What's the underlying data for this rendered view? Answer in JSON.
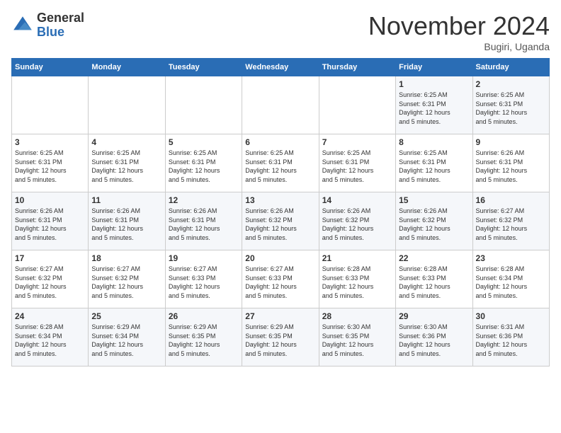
{
  "logo": {
    "general": "General",
    "blue": "Blue"
  },
  "header": {
    "month": "November 2024",
    "location": "Bugiri, Uganda"
  },
  "weekdays": [
    "Sunday",
    "Monday",
    "Tuesday",
    "Wednesday",
    "Thursday",
    "Friday",
    "Saturday"
  ],
  "weeks": [
    [
      {
        "day": "",
        "info": ""
      },
      {
        "day": "",
        "info": ""
      },
      {
        "day": "",
        "info": ""
      },
      {
        "day": "",
        "info": ""
      },
      {
        "day": "",
        "info": ""
      },
      {
        "day": "1",
        "info": "Sunrise: 6:25 AM\nSunset: 6:31 PM\nDaylight: 12 hours\nand 5 minutes."
      },
      {
        "day": "2",
        "info": "Sunrise: 6:25 AM\nSunset: 6:31 PM\nDaylight: 12 hours\nand 5 minutes."
      }
    ],
    [
      {
        "day": "3",
        "info": "Sunrise: 6:25 AM\nSunset: 6:31 PM\nDaylight: 12 hours\nand 5 minutes."
      },
      {
        "day": "4",
        "info": "Sunrise: 6:25 AM\nSunset: 6:31 PM\nDaylight: 12 hours\nand 5 minutes."
      },
      {
        "day": "5",
        "info": "Sunrise: 6:25 AM\nSunset: 6:31 PM\nDaylight: 12 hours\nand 5 minutes."
      },
      {
        "day": "6",
        "info": "Sunrise: 6:25 AM\nSunset: 6:31 PM\nDaylight: 12 hours\nand 5 minutes."
      },
      {
        "day": "7",
        "info": "Sunrise: 6:25 AM\nSunset: 6:31 PM\nDaylight: 12 hours\nand 5 minutes."
      },
      {
        "day": "8",
        "info": "Sunrise: 6:25 AM\nSunset: 6:31 PM\nDaylight: 12 hours\nand 5 minutes."
      },
      {
        "day": "9",
        "info": "Sunrise: 6:26 AM\nSunset: 6:31 PM\nDaylight: 12 hours\nand 5 minutes."
      }
    ],
    [
      {
        "day": "10",
        "info": "Sunrise: 6:26 AM\nSunset: 6:31 PM\nDaylight: 12 hours\nand 5 minutes."
      },
      {
        "day": "11",
        "info": "Sunrise: 6:26 AM\nSunset: 6:31 PM\nDaylight: 12 hours\nand 5 minutes."
      },
      {
        "day": "12",
        "info": "Sunrise: 6:26 AM\nSunset: 6:31 PM\nDaylight: 12 hours\nand 5 minutes."
      },
      {
        "day": "13",
        "info": "Sunrise: 6:26 AM\nSunset: 6:32 PM\nDaylight: 12 hours\nand 5 minutes."
      },
      {
        "day": "14",
        "info": "Sunrise: 6:26 AM\nSunset: 6:32 PM\nDaylight: 12 hours\nand 5 minutes."
      },
      {
        "day": "15",
        "info": "Sunrise: 6:26 AM\nSunset: 6:32 PM\nDaylight: 12 hours\nand 5 minutes."
      },
      {
        "day": "16",
        "info": "Sunrise: 6:27 AM\nSunset: 6:32 PM\nDaylight: 12 hours\nand 5 minutes."
      }
    ],
    [
      {
        "day": "17",
        "info": "Sunrise: 6:27 AM\nSunset: 6:32 PM\nDaylight: 12 hours\nand 5 minutes."
      },
      {
        "day": "18",
        "info": "Sunrise: 6:27 AM\nSunset: 6:32 PM\nDaylight: 12 hours\nand 5 minutes."
      },
      {
        "day": "19",
        "info": "Sunrise: 6:27 AM\nSunset: 6:33 PM\nDaylight: 12 hours\nand 5 minutes."
      },
      {
        "day": "20",
        "info": "Sunrise: 6:27 AM\nSunset: 6:33 PM\nDaylight: 12 hours\nand 5 minutes."
      },
      {
        "day": "21",
        "info": "Sunrise: 6:28 AM\nSunset: 6:33 PM\nDaylight: 12 hours\nand 5 minutes."
      },
      {
        "day": "22",
        "info": "Sunrise: 6:28 AM\nSunset: 6:33 PM\nDaylight: 12 hours\nand 5 minutes."
      },
      {
        "day": "23",
        "info": "Sunrise: 6:28 AM\nSunset: 6:34 PM\nDaylight: 12 hours\nand 5 minutes."
      }
    ],
    [
      {
        "day": "24",
        "info": "Sunrise: 6:28 AM\nSunset: 6:34 PM\nDaylight: 12 hours\nand 5 minutes."
      },
      {
        "day": "25",
        "info": "Sunrise: 6:29 AM\nSunset: 6:34 PM\nDaylight: 12 hours\nand 5 minutes."
      },
      {
        "day": "26",
        "info": "Sunrise: 6:29 AM\nSunset: 6:35 PM\nDaylight: 12 hours\nand 5 minutes."
      },
      {
        "day": "27",
        "info": "Sunrise: 6:29 AM\nSunset: 6:35 PM\nDaylight: 12 hours\nand 5 minutes."
      },
      {
        "day": "28",
        "info": "Sunrise: 6:30 AM\nSunset: 6:35 PM\nDaylight: 12 hours\nand 5 minutes."
      },
      {
        "day": "29",
        "info": "Sunrise: 6:30 AM\nSunset: 6:36 PM\nDaylight: 12 hours\nand 5 minutes."
      },
      {
        "day": "30",
        "info": "Sunrise: 6:31 AM\nSunset: 6:36 PM\nDaylight: 12 hours\nand 5 minutes."
      }
    ]
  ]
}
